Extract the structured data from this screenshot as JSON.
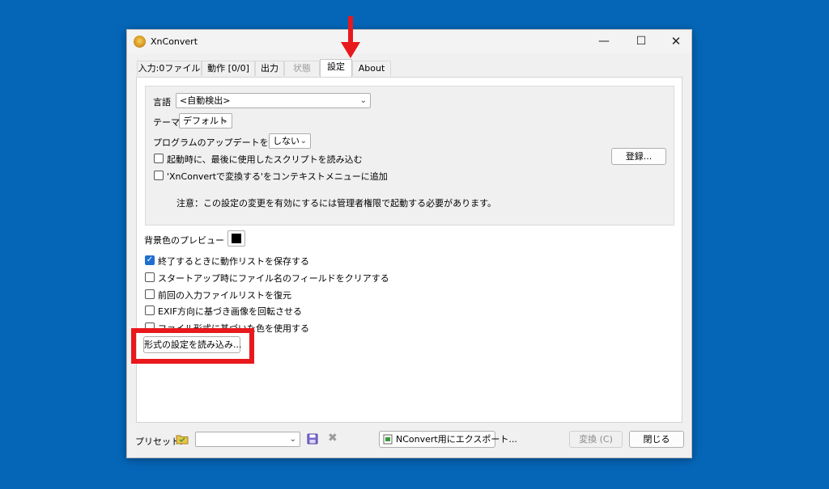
{
  "window": {
    "title": "XnConvert"
  },
  "tabs": [
    {
      "label": "入力:0ファイル"
    },
    {
      "label": "動作 [0/0]"
    },
    {
      "label": "出力"
    },
    {
      "label": "状態"
    },
    {
      "label": "設定"
    },
    {
      "label": "About"
    }
  ],
  "settings": {
    "language_label": "言語",
    "language_value": "<自動検出>",
    "theme_label": "テーマ",
    "theme_value": "デフォルト",
    "update_label": "プログラムのアップデートをチェック",
    "update_value": "しない",
    "load_script_label": "起動時に、最後に使用したスクリプトを読み込む",
    "context_menu_label": "'XnConvertで変換する'をコンテキストメニューに追加",
    "register_button": "登録...",
    "note": "注意：この設定の変更を有効にするには管理者権限で起動する必要があります。",
    "bg_preview_label": "背景色のプレビュー",
    "bg_color": "#000000",
    "options": [
      {
        "label": "終了するときに動作リストを保存する",
        "checked": true
      },
      {
        "label": "スタートアップ時にファイル名のフィールドをクリアする",
        "checked": false
      },
      {
        "label": "前回の入力ファイルリストを復元",
        "checked": false
      },
      {
        "label": "EXIF方向に基づき画像を回転させる",
        "checked": false
      },
      {
        "label": "ファイル形式に基づいた色を使用する",
        "checked": false
      }
    ],
    "load_format_button": "形式の設定を読み込み..."
  },
  "footer": {
    "preset_label": "プリセット:",
    "preset_value": "",
    "export_button": "NConvert用にエクスポート...",
    "convert_button": "変換 (C)",
    "close_button": "閉じる"
  },
  "colors": {
    "desktop": "#0566b8",
    "highlight": "#e8181c",
    "checkbox_accent": "#1f6fd0"
  }
}
